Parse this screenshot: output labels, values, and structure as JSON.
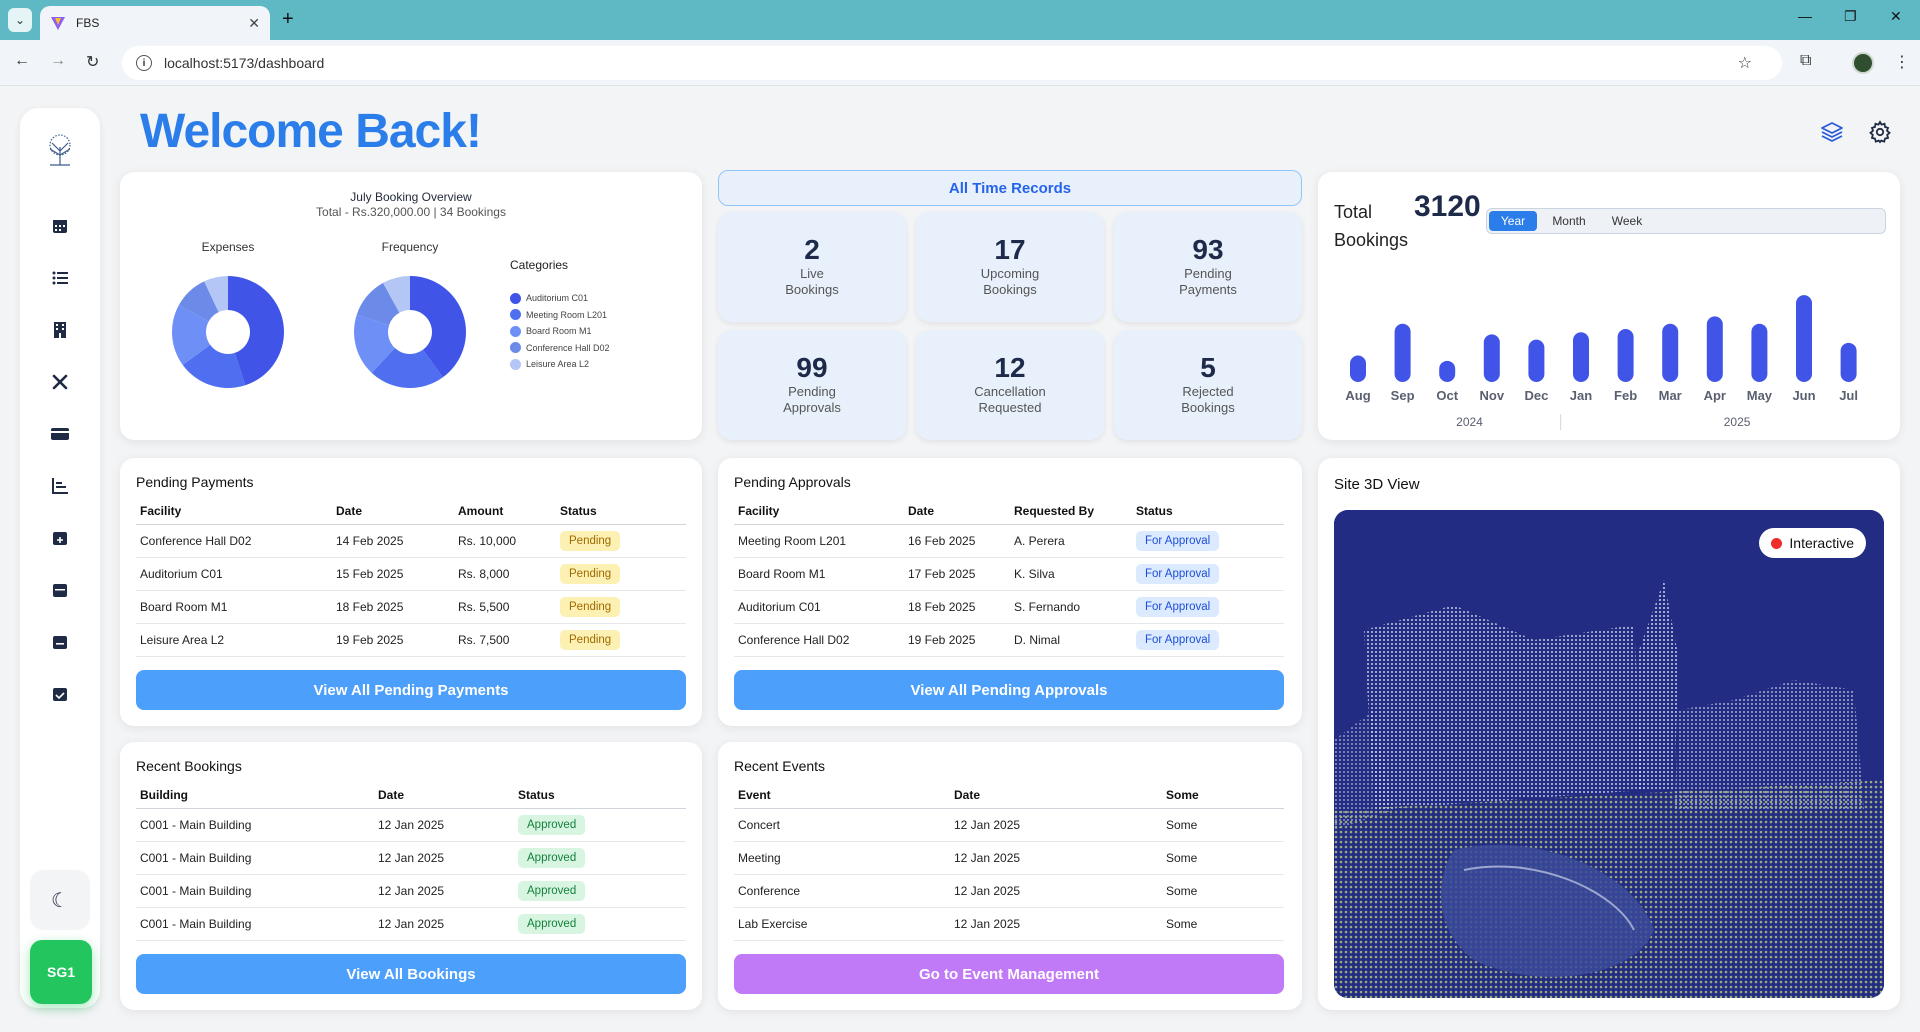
{
  "browser": {
    "tab_title": "FBS",
    "url": "localhost:5173/dashboard"
  },
  "page": {
    "welcome": "Welcome Back!"
  },
  "sidebar": {
    "icons": [
      "tree-logo-icon",
      "calendar-icon",
      "list-icon",
      "building-icon",
      "tools-icon",
      "card-icon",
      "chart-icon",
      "calendar-plus-icon",
      "calendar-check-icon",
      "calendar-minus-icon",
      "calendar-done-icon"
    ],
    "user_initials": "SG1"
  },
  "overview": {
    "title": "July Booking Overview",
    "subtitle": "Total - Rs.320,000.00 | 34 Bookings",
    "pie1_label": "Expenses",
    "pie2_label": "Frequency",
    "legend_title": "Categories",
    "categories": [
      {
        "name": "Auditorium C01",
        "color": "#4054e8"
      },
      {
        "name": "Meeting Room L201",
        "color": "#4f6ff0"
      },
      {
        "name": "Board Room M1",
        "color": "#6e8ff5"
      },
      {
        "name": "Conference Hall D02",
        "color": "#6c8ae8"
      },
      {
        "name": "Leisure Area L2",
        "color": "#b3c6f5"
      }
    ],
    "expenses": [
      45,
      20,
      18,
      10,
      7
    ],
    "frequency": [
      40,
      22,
      18,
      12,
      8
    ]
  },
  "records": {
    "header": "All Time Records",
    "stats": [
      {
        "num": "2",
        "label": "Live\nBookings"
      },
      {
        "num": "17",
        "label": "Upcoming\nBookings"
      },
      {
        "num": "93",
        "label": "Pending\nPayments"
      },
      {
        "num": "99",
        "label": "Pending\nApprovals"
      },
      {
        "num": "12",
        "label": "Cancellation\nRequested"
      },
      {
        "num": "5",
        "label": "Rejected\nBookings"
      }
    ]
  },
  "total_bookings": {
    "label1": "Total",
    "label2": "Bookings",
    "value": "3120",
    "tabs": [
      "Year",
      "Month",
      "Week"
    ],
    "active_tab": "Year",
    "year_labels": [
      "2024",
      "2025"
    ]
  },
  "chart_data": {
    "type": "bar",
    "categories": [
      "Aug",
      "Sep",
      "Oct",
      "Nov",
      "Dec",
      "Jan",
      "Feb",
      "Mar",
      "Apr",
      "May",
      "Jun",
      "Jul"
    ],
    "values": [
      25,
      55,
      20,
      45,
      40,
      47,
      50,
      55,
      62,
      55,
      82,
      37
    ],
    "title": "",
    "xlabel": "",
    "ylabel": ""
  },
  "pending_payments": {
    "title": "Pending Payments",
    "columns": [
      "Facility",
      "Date",
      "Amount",
      "Status"
    ],
    "rows": [
      [
        "Conference Hall D02",
        "14 Feb 2025",
        "Rs. 10,000",
        "Pending"
      ],
      [
        "Auditorium C01",
        "15 Feb 2025",
        "Rs. 8,000",
        "Pending"
      ],
      [
        "Board Room M1",
        "18 Feb 2025",
        "Rs. 5,500",
        "Pending"
      ],
      [
        "Leisure Area L2",
        "19 Feb 2025",
        "Rs. 7,500",
        "Pending"
      ]
    ],
    "button": "View All Pending Payments"
  },
  "pending_approvals": {
    "title": "Pending Approvals",
    "columns": [
      "Facility",
      "Date",
      "Requested By",
      "Status"
    ],
    "rows": [
      [
        "Meeting Room L201",
        "16 Feb 2025",
        "A. Perera",
        "For Approval"
      ],
      [
        "Board Room M1",
        "17 Feb 2025",
        "K. Silva",
        "For Approval"
      ],
      [
        "Auditorium C01",
        "18 Feb 2025",
        "S. Fernando",
        "For Approval"
      ],
      [
        "Conference Hall D02",
        "19 Feb 2025",
        "D. Nimal",
        "For Approval"
      ]
    ],
    "button": "View All Pending Approvals"
  },
  "recent_bookings": {
    "title": "Recent Bookings",
    "columns": [
      "Building",
      "Date",
      "Status"
    ],
    "rows": [
      [
        "C001 - Main Building",
        "12 Jan 2025",
        "Approved"
      ],
      [
        "C001 - Main Building",
        "12 Jan 2025",
        "Approved"
      ],
      [
        "C001 - Main Building",
        "12 Jan 2025",
        "Approved"
      ],
      [
        "C001 - Main Building",
        "12 Jan 2025",
        "Approved"
      ]
    ],
    "button": "View All Bookings"
  },
  "recent_events": {
    "title": "Recent Events",
    "columns": [
      "Event",
      "Date",
      "Some"
    ],
    "rows": [
      [
        "Concert",
        "12 Jan 2025",
        "Some"
      ],
      [
        "Meeting",
        "12 Jan 2025",
        "Some"
      ],
      [
        "Conference",
        "12 Jan 2025",
        "Some"
      ],
      [
        "Lab Exercise",
        "12 Jan 2025",
        "Some"
      ]
    ],
    "button": "Go to Event Management"
  },
  "site3d": {
    "title": "Site 3D View",
    "badge": "Interactive"
  },
  "colors": {
    "accent": "#2b7de9",
    "bar": "#4054e8",
    "button_blue": "#4d9ffc",
    "button_purple": "#c17af7",
    "success": "#22c55e"
  }
}
